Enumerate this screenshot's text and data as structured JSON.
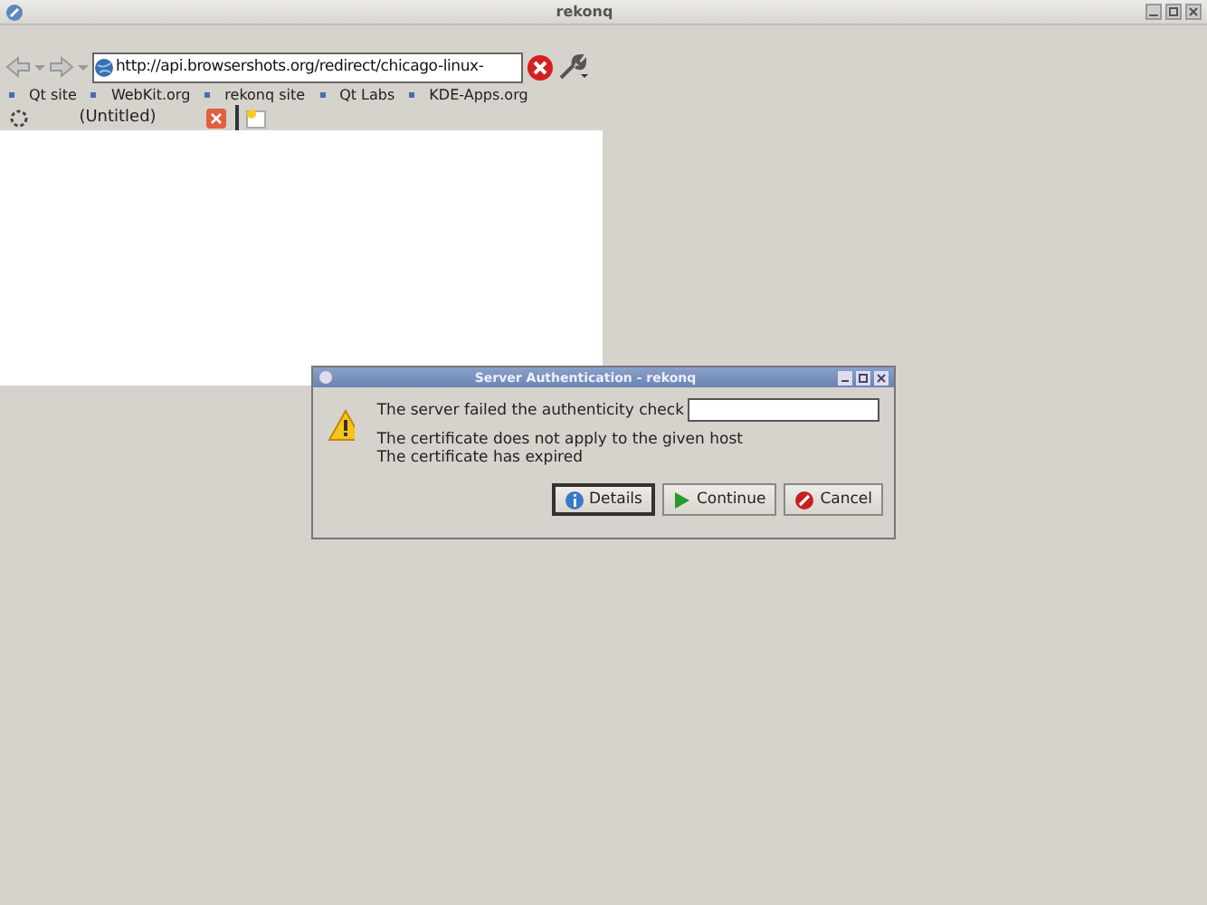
{
  "window": {
    "title": "rekonq"
  },
  "toolbar": {
    "url": "http://api.browsershots.org/redirect/chicago-linux-"
  },
  "bookmarks": [
    {
      "label": "Qt site"
    },
    {
      "label": "WebKit.org"
    },
    {
      "label": "rekonq site"
    },
    {
      "label": "Qt Labs"
    },
    {
      "label": "KDE-Apps.org"
    }
  ],
  "tabs": [
    {
      "label": "(Untitled)",
      "selected": true
    }
  ],
  "dialog": {
    "title": "Server Authentication - rekonq",
    "message": "The server failed the authenticity check",
    "details": [
      "The certificate does not apply to the given host",
      "The certificate has expired"
    ],
    "buttons": [
      {
        "label": "Details",
        "kind": "info",
        "selected": true
      },
      {
        "label": "Continue",
        "kind": "continue",
        "selected": false
      },
      {
        "label": "Cancel",
        "kind": "cancel",
        "selected": false
      }
    ]
  }
}
